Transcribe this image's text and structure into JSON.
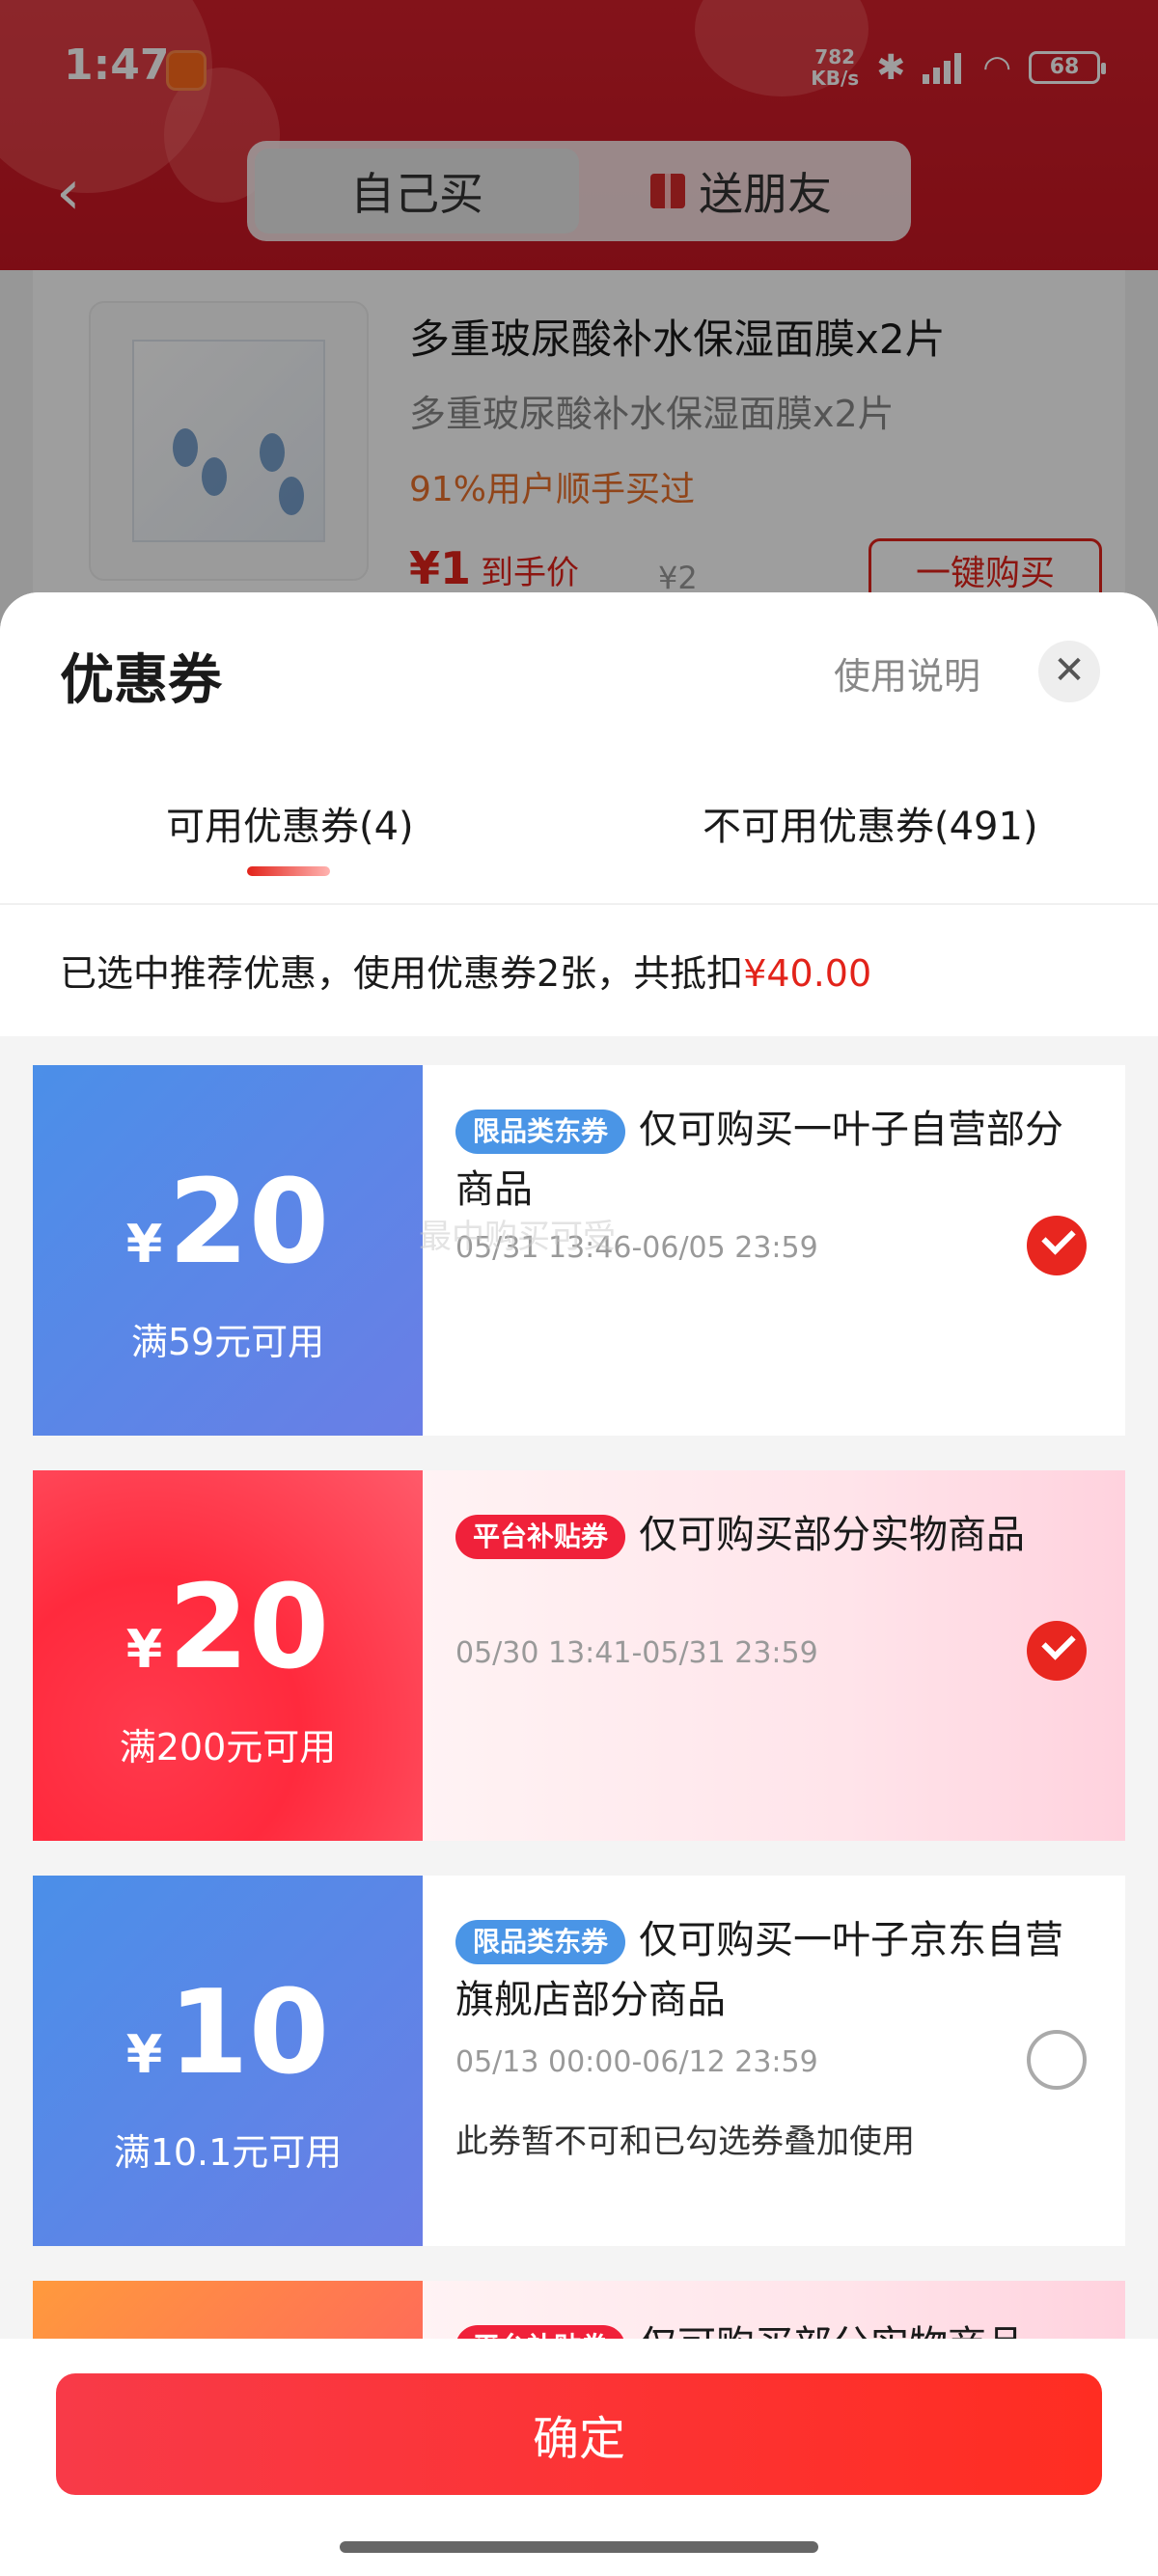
{
  "status_bar": {
    "time": "1:47",
    "net_speed_value": "782",
    "net_speed_unit": "KB/s",
    "battery": "68"
  },
  "header": {
    "tab_self": "自己买",
    "tab_gift": "送朋友"
  },
  "product": {
    "title": "多重玻尿酸补水保湿面膜x2片",
    "subtitle": "多重玻尿酸补水保湿面膜x2片",
    "hint": "91%用户顺手买过",
    "price": "¥1",
    "price_label": "到手价",
    "original_price": "¥2",
    "buy_button": "一键购买"
  },
  "sheet": {
    "title": "优惠券",
    "help_link": "使用说明",
    "close": "✕",
    "tabs": [
      {
        "label": "可用优惠券(4)",
        "active": true
      },
      {
        "label": "不可用优惠券(491)",
        "active": false
      }
    ],
    "notice_text": "已选中推荐优惠，使用优惠券2张，共抵扣",
    "notice_amount": "¥40.00",
    "watermark": "最中购买可受"
  },
  "coupons": [
    {
      "symbol": "¥",
      "amount": "20",
      "condition": "满59元可用",
      "tag": "限品类东券",
      "description": "仅可购买一叶子自营部分商品",
      "validity": "05/31 13:46-06/05 23:59",
      "note": "",
      "selected": true
    },
    {
      "symbol": "¥",
      "amount": "20",
      "condition": "满200元可用",
      "tag": "平台补贴券",
      "description": "仅可购买部分实物商品",
      "validity": "05/30 13:41-05/31 23:59",
      "note": "",
      "selected": true
    },
    {
      "symbol": "¥",
      "amount": "10",
      "condition": "满10.1元可用",
      "tag": "限品类东券",
      "description": "仅可购买一叶子京东自营旗舰店部分商品",
      "validity": "05/13 00:00-06/12 23:59",
      "note": "此券暂不可和已勾选券叠加使用",
      "selected": false
    },
    {
      "tag": "平台补贴券",
      "description": "仅可购买部分实物商品"
    }
  ],
  "footer": {
    "confirm": "确定"
  },
  "colors": {
    "brand_red": "#e2231a",
    "coupon_blue": "#4b8fe8",
    "coupon_red": "#ff2a3d"
  }
}
